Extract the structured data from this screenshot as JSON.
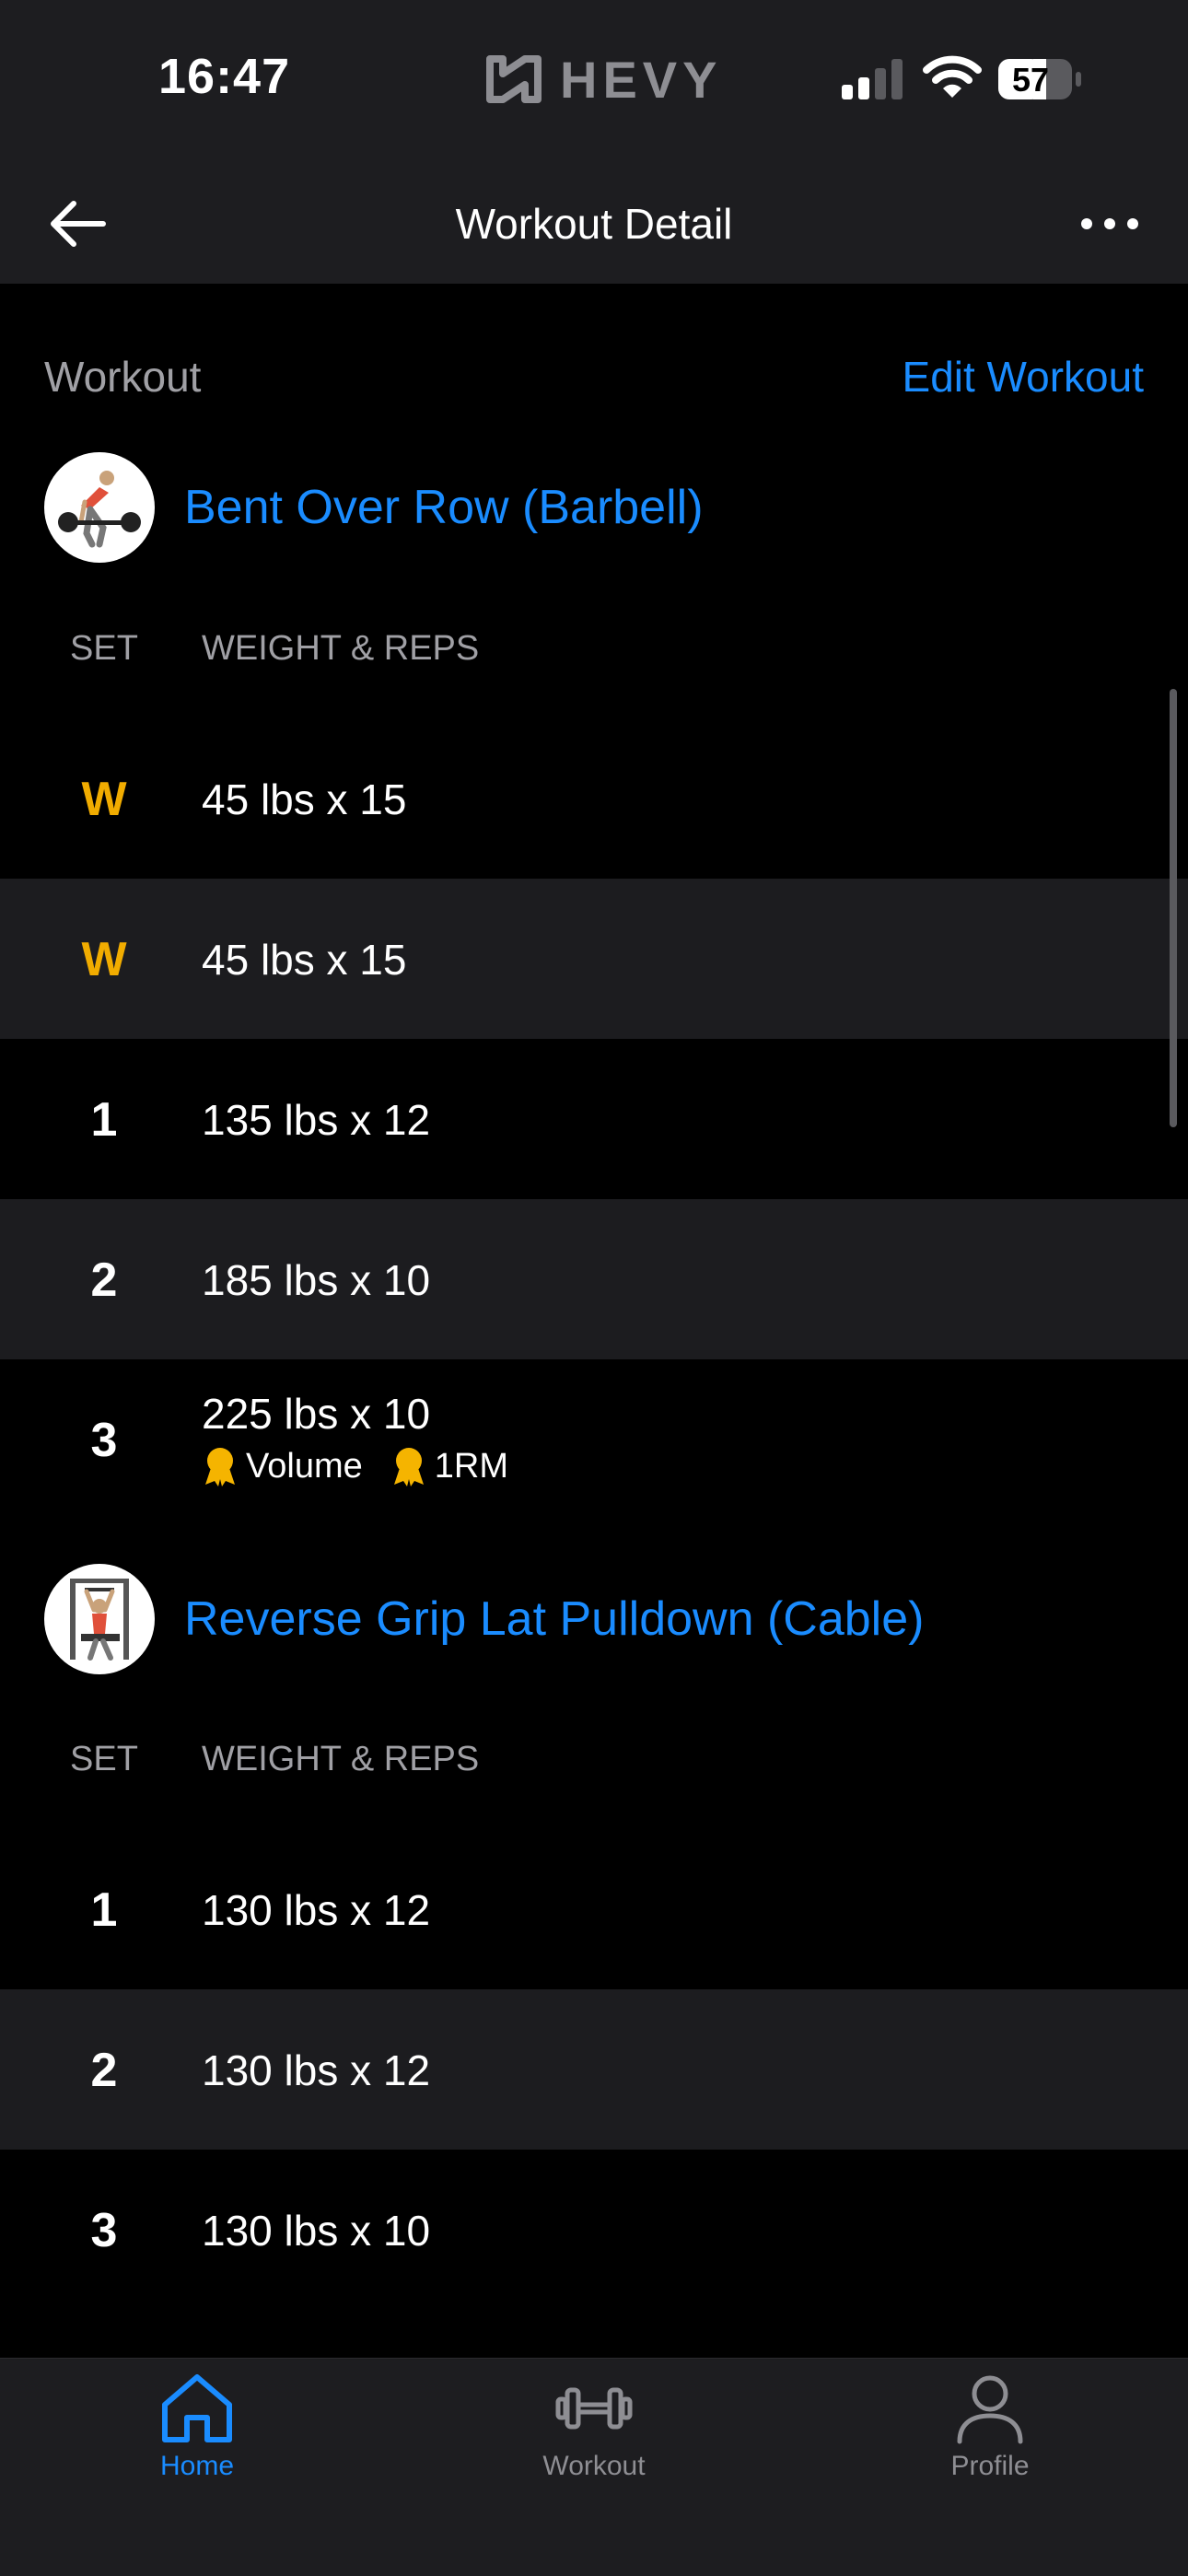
{
  "status": {
    "time": "16:47",
    "brand": "HEVY",
    "battery": "57"
  },
  "nav": {
    "title": "Workout Detail"
  },
  "section": {
    "label": "Workout",
    "edit_link": "Edit Workout"
  },
  "exercises": [
    {
      "name": "Bent Over Row (Barbell)",
      "col_set": "SET",
      "col_weight_reps": "WEIGHT & REPS",
      "sets": [
        {
          "set": "W",
          "value": "45 lbs x 15"
        },
        {
          "set": "W",
          "value": "45 lbs x 15"
        },
        {
          "set": "1",
          "value": "135 lbs x 12"
        },
        {
          "set": "2",
          "value": "185 lbs x 10"
        },
        {
          "set": "3",
          "value": "225 lbs x 10",
          "prs": [
            "Volume",
            "1RM"
          ]
        }
      ]
    },
    {
      "name": "Reverse Grip Lat Pulldown (Cable)",
      "col_set": "SET",
      "col_weight_reps": "WEIGHT & REPS",
      "sets": [
        {
          "set": "1",
          "value": "130 lbs x 12"
        },
        {
          "set": "2",
          "value": "130 lbs x 12"
        },
        {
          "set": "3",
          "value": "130 lbs x 10"
        }
      ]
    }
  ],
  "tabs": [
    {
      "label": "Home",
      "icon": "home-icon",
      "active": true
    },
    {
      "label": "Workout",
      "icon": "dumbbell-icon",
      "active": false
    },
    {
      "label": "Profile",
      "icon": "person-icon",
      "active": false
    }
  ],
  "colors": {
    "accent": "#1a8cff",
    "warmup": "#f1ac00",
    "pr_medal": "#f5b400",
    "background": "#000000",
    "bar": "#1d1d20"
  }
}
